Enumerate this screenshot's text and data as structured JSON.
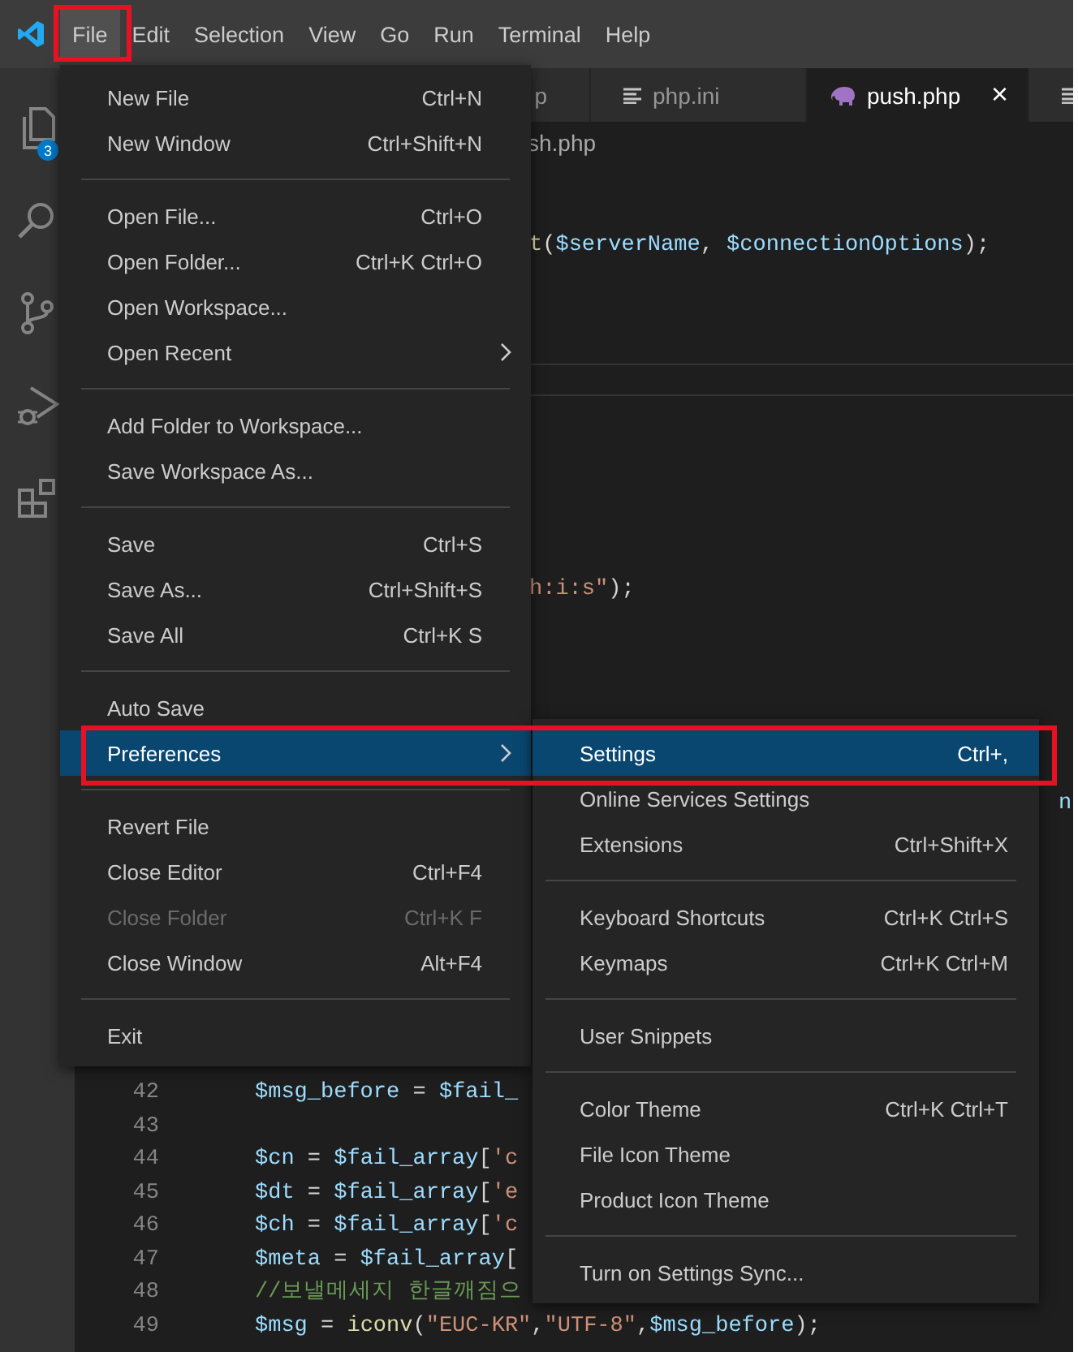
{
  "menubar": [
    {
      "label": "File",
      "selected": true
    },
    {
      "label": "Edit",
      "selected": false
    },
    {
      "label": "Selection",
      "selected": false
    },
    {
      "label": "View",
      "selected": false
    },
    {
      "label": "Go",
      "selected": false
    },
    {
      "label": "Run",
      "selected": false
    },
    {
      "label": "Terminal",
      "selected": false
    },
    {
      "label": "Help",
      "selected": false
    }
  ],
  "activity_bar": {
    "explorer_badge": "3"
  },
  "tabs": [
    {
      "kind": "fragment",
      "label": "p",
      "selected": false
    },
    {
      "kind": "text",
      "label": "php.ini",
      "selected": false
    },
    {
      "kind": "php",
      "label": "push.php",
      "selected": true,
      "close": "×"
    },
    {
      "kind": "text",
      "selected": false
    }
  ],
  "breadcrumb": "sh.php",
  "code_fragments": [
    {
      "tokens": [
        {
          "t": "t",
          "kind": "fn"
        },
        {
          "t": "(",
          "kind": "punct"
        },
        {
          "t": "$serverName",
          "kind": "var"
        },
        {
          "t": ", ",
          "kind": "punct"
        },
        {
          "t": "$connectionOptions",
          "kind": "var"
        },
        {
          "t": ");",
          "kind": "punct"
        }
      ]
    },
    {
      "tokens": [
        {
          "t": "h:i:s\"",
          "kind": "str"
        },
        {
          "t": ");",
          "kind": "punct"
        }
      ]
    },
    {
      "tokens": [
        {
          "t": "n",
          "kind": "var"
        }
      ]
    }
  ],
  "code_lines": [
    {
      "number": "42",
      "tokens": [
        {
          "t": "$msg_before",
          "kind": "var"
        },
        {
          "t": " = ",
          "kind": "punct"
        },
        {
          "t": "$fail_",
          "kind": "var"
        }
      ]
    },
    {
      "number": "43"
    },
    {
      "number": "44",
      "tokens": [
        {
          "t": "$cn",
          "kind": "var"
        },
        {
          "t": " = ",
          "kind": "punct"
        },
        {
          "t": "$fail_array",
          "kind": "var"
        },
        {
          "t": "[",
          "kind": "punct"
        },
        {
          "t": "'c",
          "kind": "str"
        }
      ]
    },
    {
      "number": "45",
      "tokens": [
        {
          "t": "$dt",
          "kind": "var"
        },
        {
          "t": " = ",
          "kind": "punct"
        },
        {
          "t": "$fail_array",
          "kind": "var"
        },
        {
          "t": "[",
          "kind": "punct"
        },
        {
          "t": "'e",
          "kind": "str"
        }
      ]
    },
    {
      "number": "46",
      "tokens": [
        {
          "t": "$ch",
          "kind": "var"
        },
        {
          "t": " = ",
          "kind": "punct"
        },
        {
          "t": "$fail_array",
          "kind": "var"
        },
        {
          "t": "[",
          "kind": "punct"
        },
        {
          "t": "'c",
          "kind": "str"
        }
      ]
    },
    {
      "number": "47",
      "tokens": [
        {
          "t": "$meta",
          "kind": "var"
        },
        {
          "t": " = ",
          "kind": "punct"
        },
        {
          "t": "$fail_array",
          "kind": "var"
        },
        {
          "t": "[",
          "kind": "punct"
        }
      ]
    },
    {
      "number": "48",
      "tokens": [
        {
          "t": "//보낼메세지 한글깨짐으",
          "kind": "comment"
        }
      ]
    },
    {
      "number": "49",
      "tokens": [
        {
          "t": "$msg",
          "kind": "var"
        },
        {
          "t": " = ",
          "kind": "punct"
        },
        {
          "t": "iconv",
          "kind": "fn"
        },
        {
          "t": "(",
          "kind": "punct"
        },
        {
          "t": "\"EUC-KR\"",
          "kind": "str"
        },
        {
          "t": ",",
          "kind": "punct"
        },
        {
          "t": "\"UTF-8\"",
          "kind": "str"
        },
        {
          "t": ",",
          "kind": "punct"
        },
        {
          "t": "$msg_before",
          "kind": "var"
        },
        {
          "t": ");",
          "kind": "punct"
        }
      ]
    }
  ],
  "file_menu": [
    {
      "kind": "item",
      "label": "New File",
      "shortcut": "Ctrl+N",
      "submenu": false,
      "disabled": false,
      "selected": false
    },
    {
      "kind": "item",
      "label": "New Window",
      "shortcut": "Ctrl+Shift+N",
      "submenu": false,
      "disabled": false,
      "selected": false
    },
    {
      "kind": "separator"
    },
    {
      "kind": "item",
      "label": "Open File...",
      "shortcut": "Ctrl+O",
      "submenu": false,
      "disabled": false,
      "selected": false
    },
    {
      "kind": "item",
      "label": "Open Folder...",
      "shortcut": "Ctrl+K Ctrl+O",
      "submenu": false,
      "disabled": false,
      "selected": false
    },
    {
      "kind": "item",
      "label": "Open Workspace...",
      "submenu": false,
      "disabled": false,
      "selected": false
    },
    {
      "kind": "item",
      "label": "Open Recent",
      "submenu": true,
      "disabled": false,
      "selected": false
    },
    {
      "kind": "separator"
    },
    {
      "kind": "item",
      "label": "Add Folder to Workspace...",
      "submenu": false,
      "disabled": false,
      "selected": false
    },
    {
      "kind": "item",
      "label": "Save Workspace As...",
      "submenu": false,
      "disabled": false,
      "selected": false
    },
    {
      "kind": "separator"
    },
    {
      "kind": "item",
      "label": "Save",
      "shortcut": "Ctrl+S",
      "submenu": false,
      "disabled": false,
      "selected": false
    },
    {
      "kind": "item",
      "label": "Save As...",
      "shortcut": "Ctrl+Shift+S",
      "submenu": false,
      "disabled": false,
      "selected": false
    },
    {
      "kind": "item",
      "label": "Save All",
      "shortcut": "Ctrl+K S",
      "submenu": false,
      "disabled": false,
      "selected": false
    },
    {
      "kind": "separator"
    },
    {
      "kind": "item",
      "label": "Auto Save",
      "submenu": false,
      "disabled": false,
      "selected": false
    },
    {
      "kind": "item",
      "label": "Preferences",
      "submenu": true,
      "disabled": false,
      "selected": true
    },
    {
      "kind": "separator"
    },
    {
      "kind": "item",
      "label": "Revert File",
      "submenu": false,
      "disabled": false,
      "selected": false
    },
    {
      "kind": "item",
      "label": "Close Editor",
      "shortcut": "Ctrl+F4",
      "submenu": false,
      "disabled": false,
      "selected": false
    },
    {
      "kind": "item",
      "label": "Close Folder",
      "shortcut": "Ctrl+K F",
      "submenu": false,
      "disabled": true,
      "selected": false
    },
    {
      "kind": "item",
      "label": "Close Window",
      "shortcut": "Alt+F4",
      "submenu": false,
      "disabled": false,
      "selected": false
    },
    {
      "kind": "separator"
    },
    {
      "kind": "item",
      "label": "Exit",
      "submenu": false,
      "disabled": false,
      "selected": false
    }
  ],
  "preferences_submenu": [
    {
      "kind": "item",
      "label": "Settings",
      "shortcut": "Ctrl+,",
      "selected": true
    },
    {
      "kind": "item",
      "label": "Online Services Settings",
      "selected": false
    },
    {
      "kind": "item",
      "label": "Extensions",
      "shortcut": "Ctrl+Shift+X",
      "selected": false
    },
    {
      "kind": "separator"
    },
    {
      "kind": "item",
      "label": "Keyboard Shortcuts",
      "shortcut": "Ctrl+K Ctrl+S",
      "selected": false
    },
    {
      "kind": "item",
      "label": "Keymaps",
      "shortcut": "Ctrl+K Ctrl+M",
      "selected": false
    },
    {
      "kind": "separator"
    },
    {
      "kind": "item",
      "label": "User Snippets",
      "selected": false
    },
    {
      "kind": "separator"
    },
    {
      "kind": "item",
      "label": "Color Theme",
      "shortcut": "Ctrl+K Ctrl+T",
      "selected": false
    },
    {
      "kind": "item",
      "label": "File Icon Theme",
      "selected": false
    },
    {
      "kind": "item",
      "label": "Product Icon Theme",
      "selected": false
    },
    {
      "kind": "separator"
    },
    {
      "kind": "item",
      "label": "Turn on Settings Sync...",
      "selected": false
    }
  ]
}
